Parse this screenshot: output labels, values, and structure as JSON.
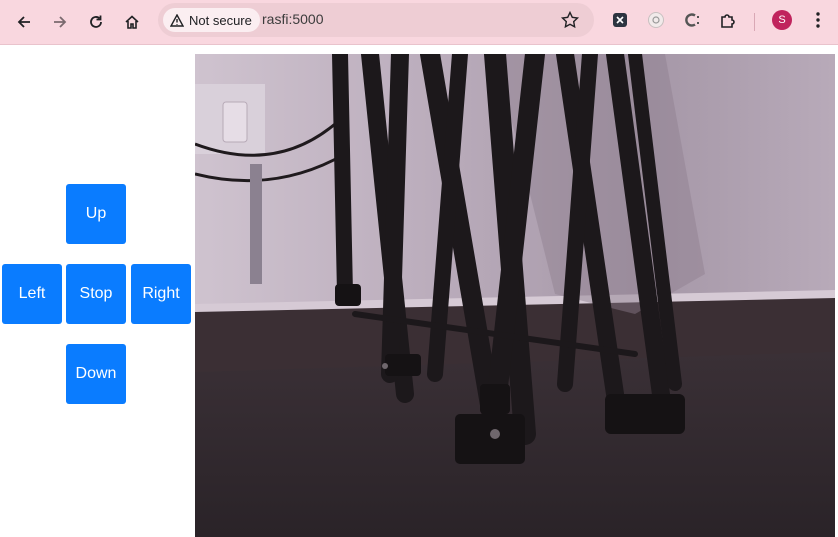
{
  "browser": {
    "security_label": "Not secure",
    "url": "rasfi:5000",
    "profile_initial": "S",
    "toolbar_color": "#f9d7df"
  },
  "controls": {
    "up": "Up",
    "left": "Left",
    "stop": "Stop",
    "right": "Right",
    "down": "Down",
    "button_color": "#0a7cff"
  },
  "camera": {
    "icon": "camera-feed",
    "description_hidden": true
  }
}
